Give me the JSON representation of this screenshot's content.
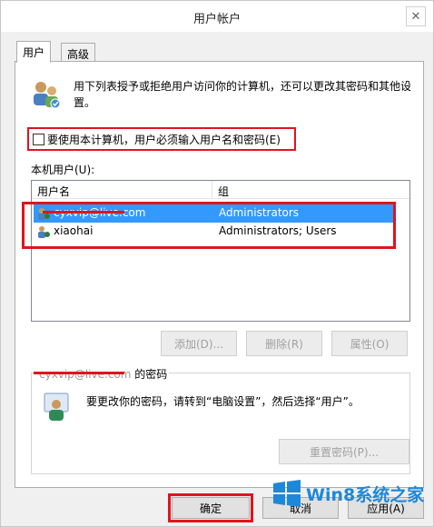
{
  "window": {
    "title": "用户帐户",
    "close_icon": "close-icon"
  },
  "tabs": [
    {
      "label": "用户",
      "active": true
    },
    {
      "label": "高级",
      "active": false
    }
  ],
  "intro": {
    "text": "用下列表授予或拒绝用户访问你的计算机，还可以更改其密码和其他设置。"
  },
  "require_login": {
    "label": "要使用本计算机，用户必须输入用户名和密码(E)",
    "checked": false
  },
  "local_users": {
    "label": "本机用户(U):",
    "columns": [
      "用户名",
      "组"
    ],
    "rows": [
      {
        "name": "cyxvip@live.com",
        "group": "Administrators",
        "selected": true
      },
      {
        "name": "xiaohai",
        "group": "Administrators; Users",
        "selected": false
      }
    ]
  },
  "list_buttons": {
    "add": "添加(D)...",
    "remove": "删除(R)",
    "properties": "属性(O)"
  },
  "password_group": {
    "legend_user": "cyxvip@live.com",
    "legend_suffix": " 的密码",
    "text": "要更改你的密码，请转到“电脑设置”，然后选择“用户”。",
    "reset_button": "重置密码(P)..."
  },
  "dialog_buttons": {
    "ok": "确定",
    "cancel": "取消",
    "apply": "应用(A)"
  },
  "watermark": {
    "text": "Win8系统之家"
  },
  "colors": {
    "highlight_red": "#e0141e",
    "selection_blue": "#3399ff",
    "watermark_blue": "#1e88d8"
  }
}
